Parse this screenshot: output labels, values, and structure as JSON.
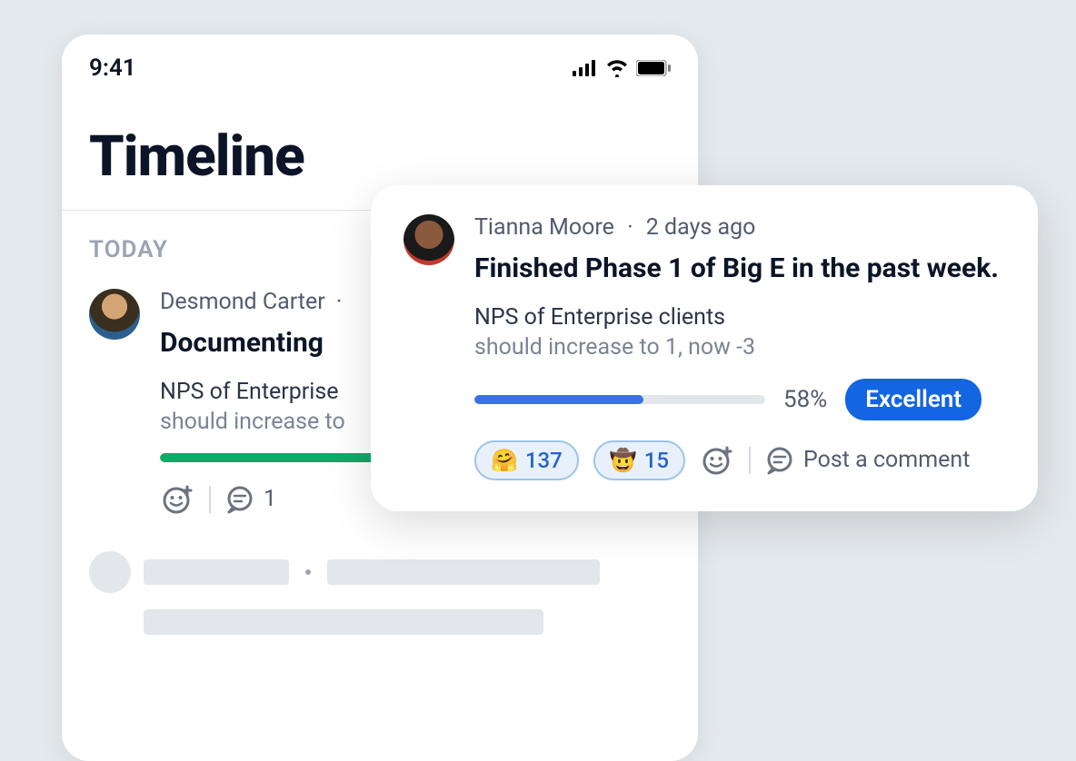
{
  "status": {
    "time": "9:41"
  },
  "page": {
    "title": "Timeline"
  },
  "section": {
    "today_label": "TODAY"
  },
  "post1": {
    "author": "Desmond Carter",
    "separator": "·",
    "title": "Documenting",
    "kr_line1": "NPS of Enterprise",
    "kr_line2": "should increase to",
    "comment_count": "1"
  },
  "post2": {
    "author": "Tianna Moore",
    "separator": "·",
    "timestamp": "2 days ago",
    "title": "Finished Phase 1 of Big E in the past week.",
    "kr_line1": "NPS of Enterprise clients",
    "kr_line2": "should increase to 1, now -3",
    "percent": "58%",
    "badge": "Excellent",
    "reaction1": {
      "emoji": "🤗",
      "count": "137"
    },
    "reaction2": {
      "emoji": "🤠",
      "count": "15"
    },
    "comment_prompt": "Post a comment"
  }
}
